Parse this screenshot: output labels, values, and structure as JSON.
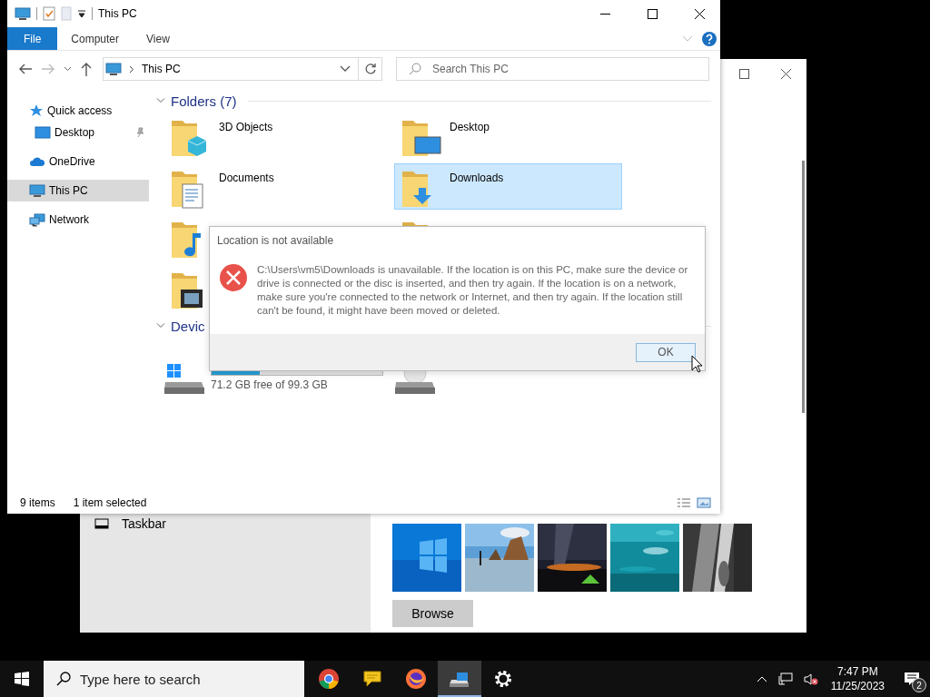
{
  "settings_window": {
    "nav_items": [
      {
        "label": "Taskbar",
        "selected": false
      }
    ],
    "browse_button": "Browse"
  },
  "explorer": {
    "title": "This PC",
    "ribbon_tabs": [
      {
        "label": "File",
        "selected": true
      },
      {
        "label": "Computer",
        "selected": false
      },
      {
        "label": "View",
        "selected": false
      }
    ],
    "address": "This PC",
    "search": {
      "placeholder": "Search This PC"
    },
    "nav_items": [
      {
        "label": "Quick access",
        "kind": "star",
        "selected": false,
        "children": [
          {
            "label": "Desktop",
            "kind": "desktop",
            "pinned": true,
            "selected": false
          }
        ]
      },
      {
        "label": "OneDrive",
        "kind": "cloud",
        "selected": false
      },
      {
        "label": "This PC",
        "kind": "pc",
        "selected": true
      },
      {
        "label": "Network",
        "kind": "network",
        "selected": false
      }
    ],
    "folders": {
      "title": "Folders (7)",
      "expanded": true,
      "items": [
        {
          "name": "3D Objects",
          "kind": "cube",
          "selected": false
        },
        {
          "name": "Desktop",
          "kind": "desktop",
          "selected": false
        },
        {
          "name": "Documents",
          "kind": "documents",
          "selected": false
        },
        {
          "name": "Downloads",
          "kind": "downloads",
          "selected": true
        },
        {
          "kind": "music",
          "selected": false
        },
        {
          "kind": "pictures",
          "selected": false
        },
        {
          "kind": "videos",
          "selected": false
        }
      ]
    },
    "drives": {
      "title": "Devic",
      "expanded": true,
      "items": [
        {
          "kind": "disk",
          "level": 0.28,
          "free": "71.2 GB free of 99.3 GB"
        },
        {
          "kind": "cd"
        }
      ]
    },
    "status": {
      "count": "9 items",
      "selection": "1 item selected"
    }
  },
  "dialog": {
    "title": "Location is not available",
    "message": "C:\\Users\\vm5\\Downloads is unavailable. If the location is on this PC, make sure the device or drive is connected or the disc is inserted, and then try again. If the location is on a network, make sure you're connected to the network or Internet, and then try again. If the location still can't be found, it might have been moved or deleted.",
    "button": "OK"
  },
  "taskbar": {
    "search_placeholder": "Type here to search",
    "apps": [
      {
        "kind": "chrome",
        "active": false
      },
      {
        "kind": "notes",
        "active": false
      },
      {
        "kind": "firefox",
        "active": false
      },
      {
        "kind": "explorer",
        "active": true
      },
      {
        "kind": "settings",
        "active": false
      }
    ],
    "time": "7:47 PM",
    "date": "11/25/2023",
    "notifications": "2"
  }
}
